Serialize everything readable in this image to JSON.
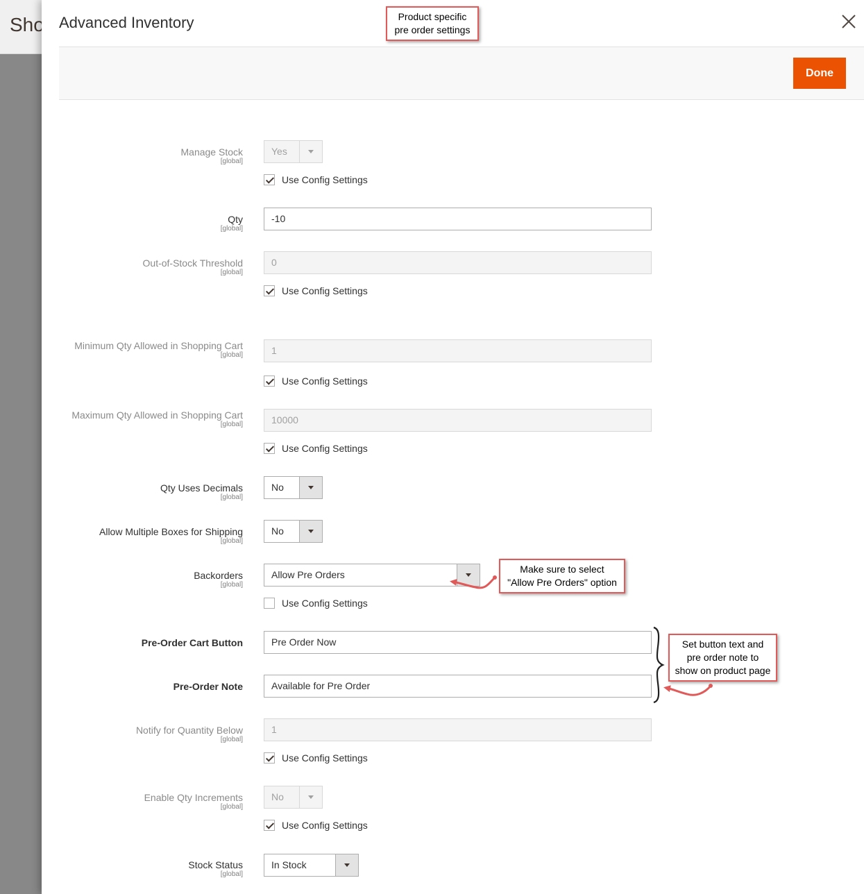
{
  "background": {
    "title": "Shop"
  },
  "modal": {
    "title": "Advanced Inventory",
    "done_label": "Done"
  },
  "scope_label": "[global]",
  "use_config_label": "Use Config Settings",
  "fields": {
    "manage_stock": {
      "label": "Manage Stock",
      "value": "Yes",
      "use_config": true
    },
    "qty": {
      "label": "Qty",
      "value": "-10"
    },
    "out_of_stock_threshold": {
      "label": "Out-of-Stock Threshold",
      "value": "0",
      "use_config": true
    },
    "min_qty_cart": {
      "label": "Minimum Qty Allowed in Shopping Cart",
      "value": "1",
      "use_config": true
    },
    "max_qty_cart": {
      "label": "Maximum Qty Allowed in Shopping Cart",
      "value": "10000",
      "use_config": true
    },
    "qty_uses_decimals": {
      "label": "Qty Uses Decimals",
      "value": "No"
    },
    "allow_multiple_boxes": {
      "label": "Allow Multiple Boxes for Shipping",
      "value": "No"
    },
    "backorders": {
      "label": "Backorders",
      "value": "Allow Pre Orders",
      "use_config": false
    },
    "preorder_cart_button": {
      "label": "Pre-Order Cart Button",
      "value": "Pre Order Now"
    },
    "preorder_note": {
      "label": "Pre-Order Note",
      "value": "Available for Pre Order"
    },
    "notify_qty_below": {
      "label": "Notify for Quantity Below",
      "value": "1",
      "use_config": true
    },
    "enable_qty_increments": {
      "label": "Enable Qty Increments",
      "value": "No",
      "use_config": true
    },
    "stock_status": {
      "label": "Stock Status",
      "value": "In Stock"
    }
  },
  "annotations": {
    "top_note": [
      "Product specific",
      "pre order settings"
    ],
    "backorders_note": [
      "Make sure to select",
      "\"Allow Pre Orders\" option"
    ],
    "preorder_note": [
      "Set button text and",
      "pre order note to",
      "show on product page"
    ]
  },
  "colors": {
    "accent": "#eb5202",
    "callout_border": "#e05a5a"
  }
}
